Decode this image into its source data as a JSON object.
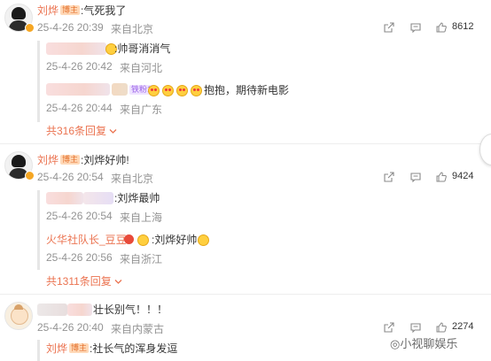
{
  "comments": [
    {
      "author": "刘烨",
      "badge": "博主",
      "text": ":气死我了",
      "time": "25-4-26 20:39",
      "location": "来自北京",
      "likes": "8612",
      "replies": [
        {
          "text": ":帅哥消消气",
          "time": "25-4-26 20:42",
          "location": "来自河北"
        },
        {
          "tag": "铁粉1",
          "text": "抱抱，期待新电影",
          "time": "25-4-26 20:44",
          "location": "来自广东"
        }
      ],
      "more": "共316条回复"
    },
    {
      "author": "刘烨",
      "badge": "博主",
      "text": ":刘烨好帅!",
      "time": "25-4-26 20:54",
      "location": "来自北京",
      "likes": "9424",
      "replies": [
        {
          "text": ":刘烨最帅",
          "time": "25-4-26 20:54",
          "location": "来自上海"
        },
        {
          "author": "火华社队长_豆豆",
          "text": ":刘烨好帅",
          "time": "25-4-26 20:56",
          "location": "来自浙江"
        }
      ],
      "more": "共1311条回复"
    },
    {
      "text": "壮长别气！！！",
      "time": "25-4-26 20:40",
      "location": "来自内蒙古",
      "likes": "2274",
      "replies": [
        {
          "author": "刘烨",
          "badge": "博主",
          "text": ":社长气的浑身发逗"
        }
      ]
    }
  ],
  "watermark": "小视聊娱乐",
  "colors": {
    "accent": "#eb7350",
    "meta": "#939393",
    "badge_bg": "#ffd9b8"
  },
  "icons": [
    "share-icon",
    "comment-icon",
    "like-icon",
    "chevron-down-icon",
    "verified-badge-icon"
  ]
}
